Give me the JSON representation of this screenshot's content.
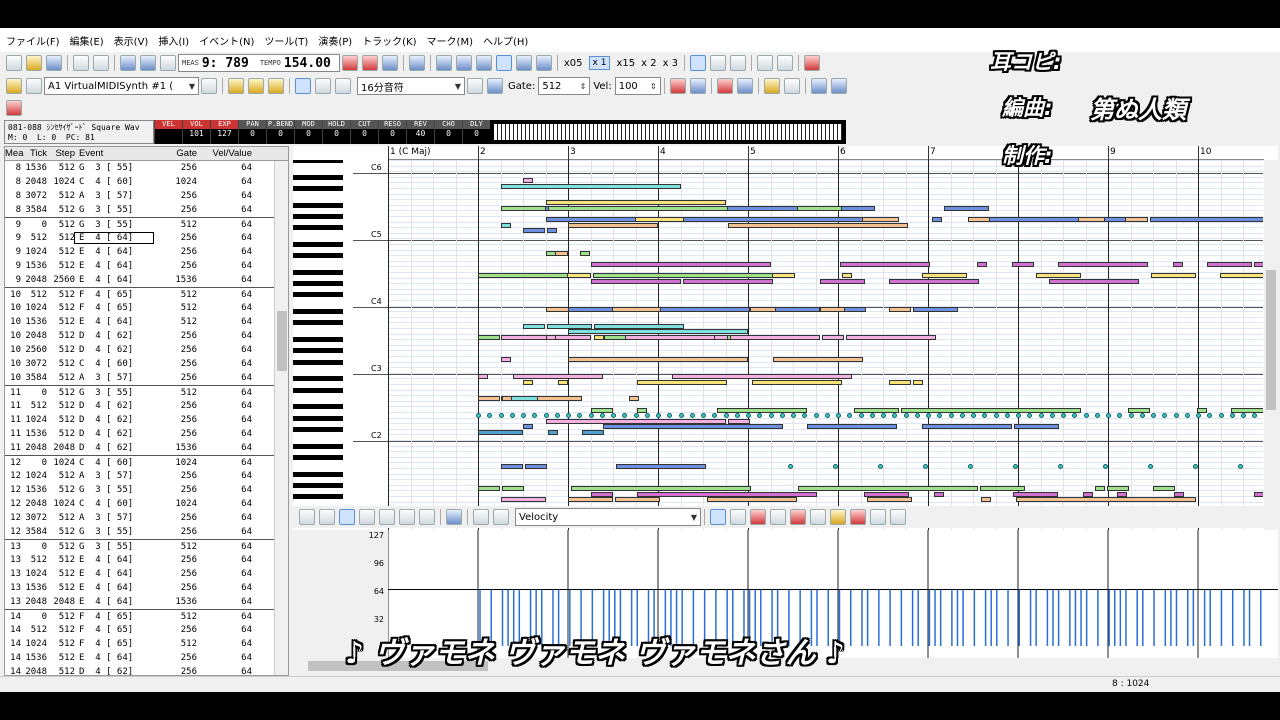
{
  "menu": [
    "ファイル(F)",
    "編集(E)",
    "表示(V)",
    "挿入(I)",
    "イベント(N)",
    "ツール(T)",
    "演奏(P)",
    "トラック(K)",
    "マーク(M)",
    "ヘルプ(H)"
  ],
  "transport": {
    "meas_label": "MEAS",
    "meas_value": "9: 789",
    "tempo_label": "TEMPO",
    "tempo_value": "154.00",
    "speeds": [
      "x05",
      "x 1",
      "x15",
      "x 2",
      "x 3"
    ]
  },
  "toolbar2": {
    "port": "A1 VirtualMIDISynth #1 (",
    "snap": "16分音符",
    "gate_label": "Gate:",
    "gate_value": "512",
    "vel_label": "Vel:",
    "vel_value": "100"
  },
  "channel": {
    "name": "081-088 ｼﾝｾｻｲｻﾞｰﾄﾞ Square Wav",
    "m_label": "M:",
    "m_value": "0",
    "l_label": "L:",
    "l_value": "0",
    "pc_label": "PC:",
    "pc_value": "81",
    "controls": [
      {
        "name": "VEL",
        "value": ""
      },
      {
        "name": "VOL",
        "value": "101"
      },
      {
        "name": "EXP",
        "value": "127"
      },
      {
        "name": "PAN",
        "value": "0"
      },
      {
        "name": "P.BEND",
        "value": "0"
      },
      {
        "name": "MOD",
        "value": "0"
      },
      {
        "name": "HOLD",
        "value": "0"
      },
      {
        "name": "CUT",
        "value": "0"
      },
      {
        "name": "RESO",
        "value": "0"
      },
      {
        "name": "REV",
        "value": "40"
      },
      {
        "name": "CHO",
        "value": "0"
      },
      {
        "name": "DLY",
        "value": "0"
      }
    ]
  },
  "event_list": {
    "headers": [
      "Mea",
      "Tick",
      "Step",
      "Event",
      "Gate",
      "Vel/Value"
    ],
    "rows": [
      [
        "8",
        "1536",
        "512",
        "G  3 [ 55]",
        "256",
        "64"
      ],
      [
        "8",
        "2048",
        "1024",
        "C  4 [ 60]",
        "1024",
        "64"
      ],
      [
        "8",
        "3072",
        "512",
        "A  3 [ 57]",
        "256",
        "64"
      ],
      [
        "8",
        "3584",
        "512",
        "G  3 [ 55]",
        "256",
        "64"
      ],
      [
        "9",
        "0",
        "512",
        "G  3 [ 55]",
        "512",
        "64"
      ],
      [
        "9",
        "512",
        "512",
        "E  4 [ 64]",
        "256",
        "64"
      ],
      [
        "9",
        "1024",
        "512",
        "E  4 [ 64]",
        "256",
        "64"
      ],
      [
        "9",
        "1536",
        "512",
        "E  4 [ 64]",
        "256",
        "64"
      ],
      [
        "9",
        "2048",
        "2560",
        "E  4 [ 64]",
        "1536",
        "64"
      ],
      [
        "10",
        "512",
        "512",
        "F  4 [ 65]",
        "512",
        "64"
      ],
      [
        "10",
        "1024",
        "512",
        "F  4 [ 65]",
        "512",
        "64"
      ],
      [
        "10",
        "1536",
        "512",
        "E  4 [ 64]",
        "512",
        "64"
      ],
      [
        "10",
        "2048",
        "512",
        "D  4 [ 62]",
        "256",
        "64"
      ],
      [
        "10",
        "2560",
        "512",
        "D  4 [ 62]",
        "256",
        "64"
      ],
      [
        "10",
        "3072",
        "512",
        "C  4 [ 60]",
        "256",
        "64"
      ],
      [
        "10",
        "3584",
        "512",
        "A  3 [ 57]",
        "256",
        "64"
      ],
      [
        "11",
        "0",
        "512",
        "G  3 [ 55]",
        "512",
        "64"
      ],
      [
        "11",
        "512",
        "512",
        "D  4 [ 62]",
        "256",
        "64"
      ],
      [
        "11",
        "1024",
        "512",
        "D  4 [ 62]",
        "256",
        "64"
      ],
      [
        "11",
        "1536",
        "512",
        "D  4 [ 62]",
        "256",
        "64"
      ],
      [
        "11",
        "2048",
        "2048",
        "D  4 [ 62]",
        "1536",
        "64"
      ],
      [
        "12",
        "0",
        "1024",
        "C  4 [ 60]",
        "1024",
        "64"
      ],
      [
        "12",
        "1024",
        "512",
        "A  3 [ 57]",
        "256",
        "64"
      ],
      [
        "12",
        "1536",
        "512",
        "G  3 [ 55]",
        "256",
        "64"
      ],
      [
        "12",
        "2048",
        "1024",
        "C  4 [ 60]",
        "1024",
        "64"
      ],
      [
        "12",
        "3072",
        "512",
        "A  3 [ 57]",
        "256",
        "64"
      ],
      [
        "12",
        "3584",
        "512",
        "G  3 [ 55]",
        "256",
        "64"
      ],
      [
        "13",
        "0",
        "512",
        "G  3 [ 55]",
        "512",
        "64"
      ],
      [
        "13",
        "512",
        "512",
        "E  4 [ 64]",
        "256",
        "64"
      ],
      [
        "13",
        "1024",
        "512",
        "E  4 [ 64]",
        "256",
        "64"
      ],
      [
        "13",
        "1536",
        "512",
        "E  4 [ 64]",
        "256",
        "64"
      ],
      [
        "13",
        "2048",
        "2048",
        "E  4 [ 64]",
        "1536",
        "64"
      ],
      [
        "14",
        "0",
        "512",
        "F  4 [ 65]",
        "512",
        "64"
      ],
      [
        "14",
        "512",
        "512",
        "F  4 [ 65]",
        "256",
        "64"
      ],
      [
        "14",
        "1024",
        "512",
        "F  4 [ 65]",
        "512",
        "64"
      ],
      [
        "14",
        "1536",
        "512",
        "E  4 [ 64]",
        "256",
        "64"
      ],
      [
        "14",
        "2048",
        "512",
        "D  4 [ 62]",
        "256",
        "64"
      ]
    ]
  },
  "piano_roll": {
    "measures": [
      "1 (C Maj)",
      "2",
      "3",
      "4",
      "5",
      "6",
      "7",
      "8",
      "9",
      "10"
    ],
    "octave_labels": [
      "C6",
      "C5",
      "C4",
      "C3",
      "C2"
    ]
  },
  "controller": {
    "type": "Velocity",
    "y_labels": [
      "127",
      "96",
      "64",
      "32",
      "0"
    ]
  },
  "status": {
    "position": "8 : 1024"
  },
  "overlay": {
    "line1": "耳コピ:",
    "line2_label": "編曲:",
    "line2_value": "第ぬ人類",
    "line3": "制作:",
    "lyric": "♪ ヴァモネ ヴァモネ ヴァモネさん ♪"
  }
}
